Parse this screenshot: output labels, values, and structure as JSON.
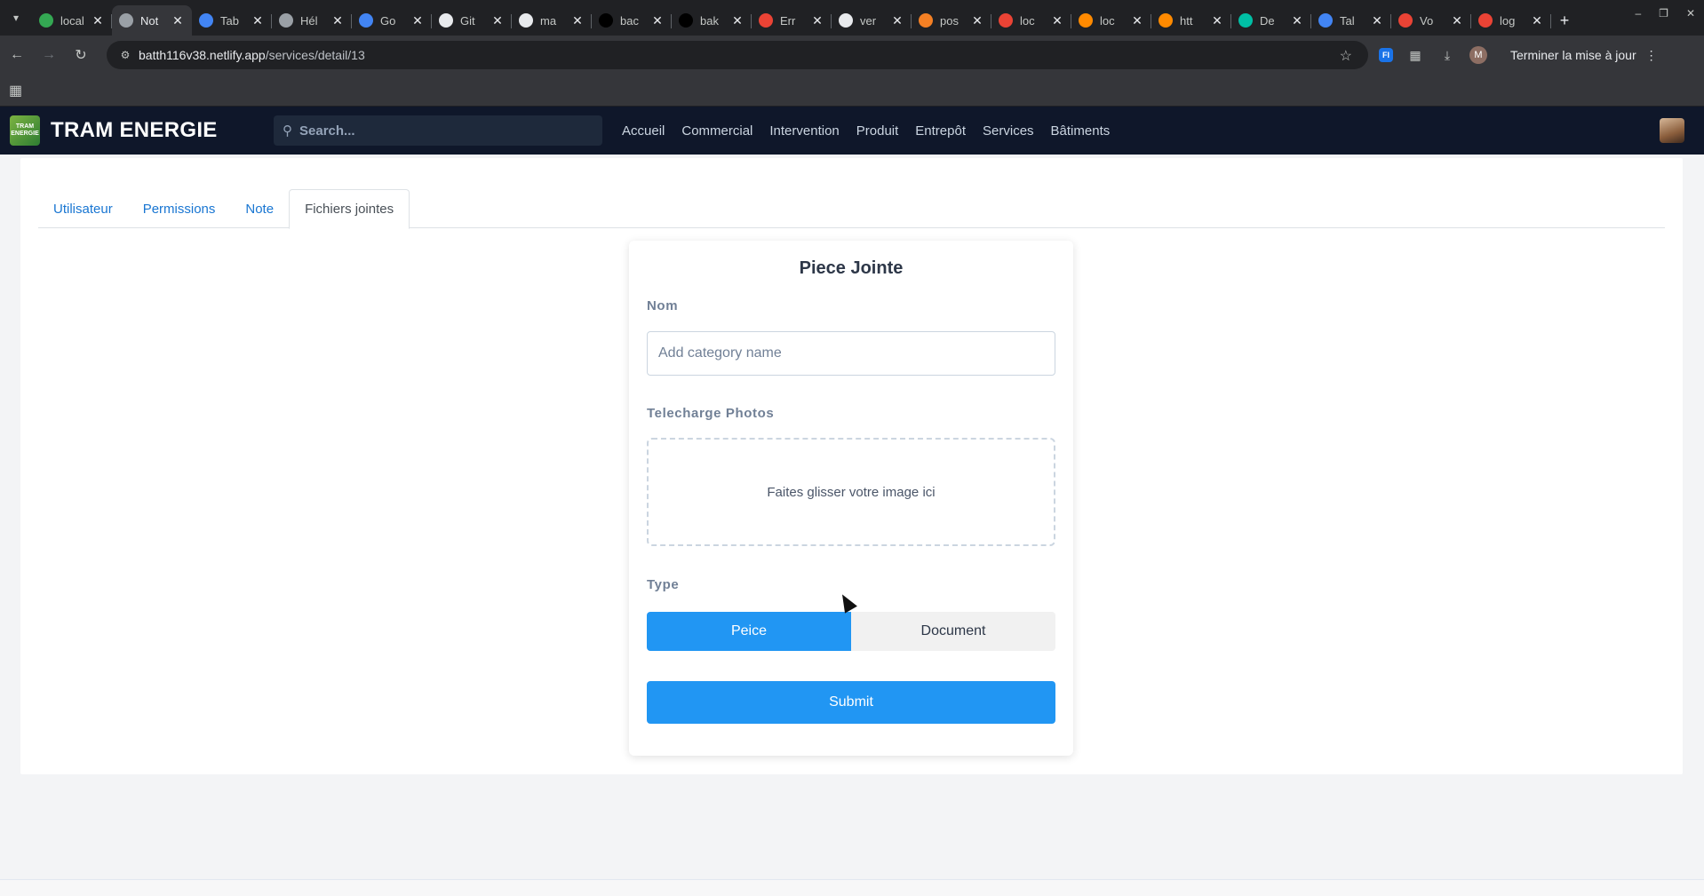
{
  "browser": {
    "tabs": [
      {
        "title": "local",
        "icon": "vercel-triangle-icon",
        "color": "#34a853",
        "active": false
      },
      {
        "title": "Not",
        "icon": "globe-icon",
        "color": "#9aa0a6",
        "active": true
      },
      {
        "title": "Tab",
        "icon": "tab-icon",
        "color": "#4285f4",
        "active": false
      },
      {
        "title": "Hél",
        "icon": "openai-icon",
        "color": "#9aa0a6",
        "active": false
      },
      {
        "title": "Go",
        "icon": "gemini-icon",
        "color": "#4285f4",
        "active": false
      },
      {
        "title": "Git",
        "icon": "github-icon",
        "color": "#e8eaed",
        "active": false
      },
      {
        "title": "ma",
        "icon": "github-icon",
        "color": "#e8eaed",
        "active": false
      },
      {
        "title": "bac",
        "icon": "vercel-triangle-icon",
        "color": "#000000",
        "active": false
      },
      {
        "title": "bak",
        "icon": "vercel-triangle-icon",
        "color": "#000000",
        "active": false
      },
      {
        "title": "Err",
        "icon": "google-icon",
        "color": "#ea4335",
        "active": false
      },
      {
        "title": "ver",
        "icon": "github-icon",
        "color": "#e8eaed",
        "active": false
      },
      {
        "title": "pos",
        "icon": "stackoverflow-icon",
        "color": "#f48024",
        "active": false
      },
      {
        "title": "loc",
        "icon": "google-icon",
        "color": "#ea4335",
        "active": false
      },
      {
        "title": "loc",
        "icon": "anthill-icon",
        "color": "#ff8a00",
        "active": false
      },
      {
        "title": "htt",
        "icon": "anthill-icon",
        "color": "#ff8a00",
        "active": false
      },
      {
        "title": "De",
        "icon": "diamond-icon",
        "color": "#00bfa5",
        "active": false
      },
      {
        "title": "Tal",
        "icon": "tab-icon",
        "color": "#4285f4",
        "active": false
      },
      {
        "title": "Vo",
        "icon": "gmail-icon",
        "color": "#ea4335",
        "active": false
      },
      {
        "title": "log",
        "icon": "google-icon",
        "color": "#ea4335",
        "active": false
      }
    ],
    "url_host": "batth116v38.netlify.app",
    "url_path": "/services/detail/13",
    "profile_initial": "M",
    "update_label": "Terminer la mise à jour"
  },
  "app": {
    "brand": "TRAM ENERGIE",
    "logo_text": "TRAM ENERGIE",
    "search_placeholder": "Search...",
    "menu": [
      "Accueil",
      "Commercial",
      "Intervention",
      "Produit",
      "Entrepôt",
      "Services",
      "Bâtiments"
    ]
  },
  "tabs": [
    {
      "label": "Utilisateur",
      "active": false
    },
    {
      "label": "Permissions",
      "active": false
    },
    {
      "label": "Note",
      "active": false
    },
    {
      "label": "Fichiers jointes",
      "active": true
    }
  ],
  "form": {
    "title": "Piece Jointe",
    "name_label": "Nom",
    "name_placeholder": "Add category name",
    "name_value": "",
    "photos_label": "Telecharge Photos",
    "dropzone_text": "Faites glisser votre image ici",
    "type_label": "Type",
    "type_options": [
      "Peice",
      "Document"
    ],
    "type_selected": "Peice",
    "submit_label": "Submit"
  },
  "colors": {
    "accent": "#2196f3",
    "navbar": "#0f172a",
    "tab_link": "#1976d2"
  }
}
